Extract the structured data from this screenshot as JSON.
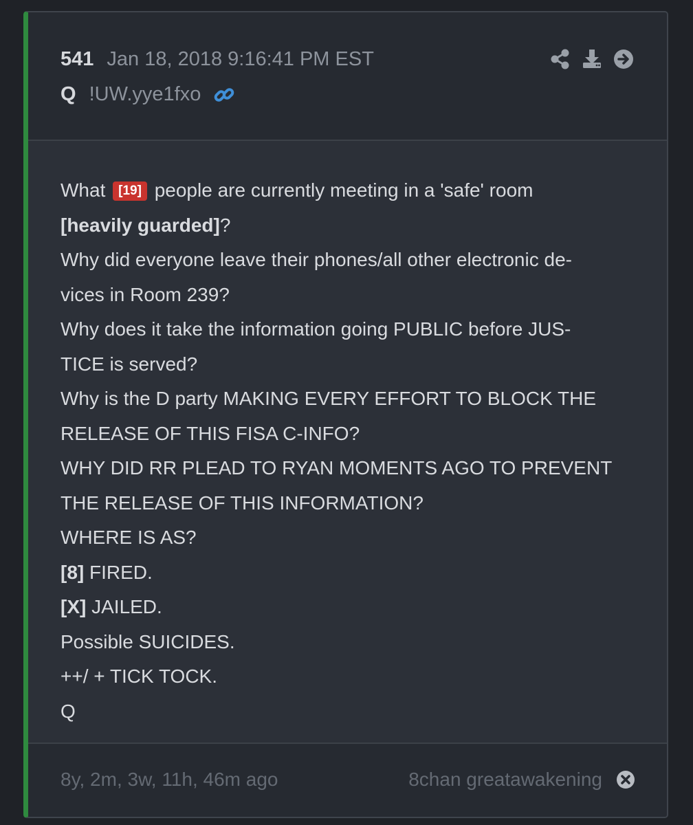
{
  "post": {
    "number": "541",
    "datetime": "Jan 18, 2018 9:16:41 PM EST",
    "author": "Q",
    "tripcode": "!UW.yye1fxo",
    "accent_color": "#2f8a3f"
  },
  "actions": {
    "icons": [
      "share-icon",
      "download-icon",
      "arrow-right-icon"
    ]
  },
  "body": {
    "l1_before": "What ",
    "l1_badge": "[19]",
    "l1_after": " people are currently meeting in a 'safe' room",
    "l2_bold": "[heavily guarded]",
    "l2_after": "?",
    "l3": "Why did everyone leave their phones/all other electronic de-",
    "l4": "vices in Room 239?",
    "l5": "Why does it take the information going PUBLIC before JUS-",
    "l6": "TICE is served?",
    "l7": "Why is the D party MAKING EVERY EFFORT TO BLOCK THE",
    "l8": "RELEASE OF THIS FISA C-INFO?",
    "l9": "WHY DID RR PLEAD TO RYAN MOMENTS AGO TO PREVENT",
    "l10": "THE RELEASE OF THIS INFORMATION?",
    "l11": "WHERE IS AS?",
    "l12_bold": "[8]",
    "l12_after": " FIRED.",
    "l13_bold": "[X]",
    "l13_after": " JAILED.",
    "l14": "Possible SUICIDES.",
    "l15": "++/ + TICK TOCK.",
    "l16": "Q",
    "badge_color": "#c9342e"
  },
  "footer": {
    "age": "8y, 2m, 3w, 11h, 46m ago",
    "board": "8chan greatawakening"
  }
}
